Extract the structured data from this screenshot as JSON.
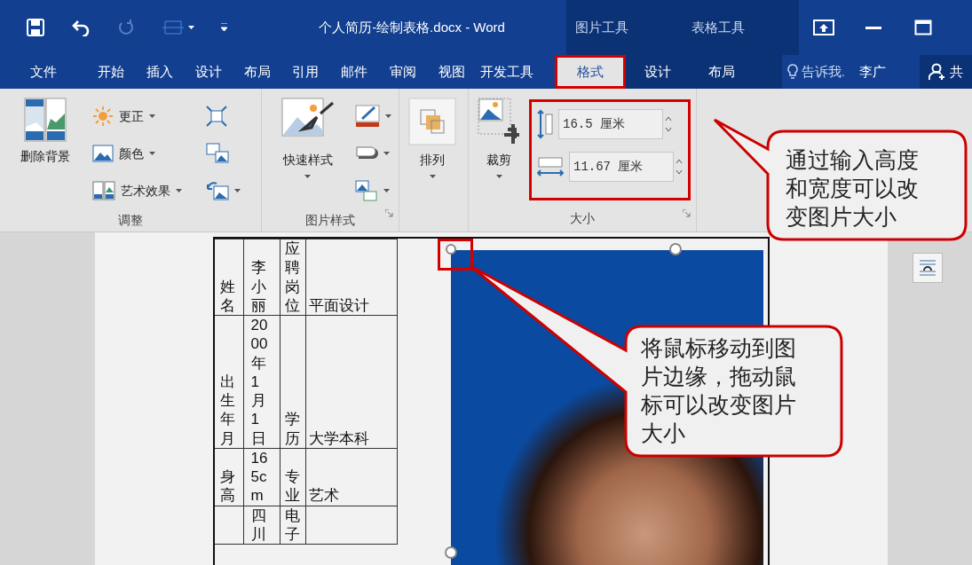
{
  "title_bar": {
    "title": "个人简历-绘制表格.docx - Word",
    "context_labels": [
      "图片工具",
      "表格工具"
    ]
  },
  "tabs": [
    {
      "label": "文件",
      "selected": false,
      "contextual": false,
      "highlighted": false
    },
    {
      "label": "开始",
      "selected": false,
      "contextual": false,
      "highlighted": false
    },
    {
      "label": "插入",
      "selected": false,
      "contextual": false,
      "highlighted": false
    },
    {
      "label": "设计",
      "selected": false,
      "contextual": false,
      "highlighted": false
    },
    {
      "label": "布局",
      "selected": false,
      "contextual": false,
      "highlighted": false
    },
    {
      "label": "引用",
      "selected": false,
      "contextual": false,
      "highlighted": false
    },
    {
      "label": "邮件",
      "selected": false,
      "contextual": false,
      "highlighted": false
    },
    {
      "label": "审阅",
      "selected": false,
      "contextual": false,
      "highlighted": false
    },
    {
      "label": "视图",
      "selected": false,
      "contextual": false,
      "highlighted": false
    },
    {
      "label": "开发工具",
      "selected": false,
      "contextual": false,
      "highlighted": false
    },
    {
      "label": "格式",
      "selected": true,
      "contextual": true,
      "highlighted": true
    },
    {
      "label": "设计",
      "selected": false,
      "contextual": true,
      "highlighted": false
    },
    {
      "label": "布局",
      "selected": false,
      "contextual": true,
      "highlighted": false
    }
  ],
  "tell_me": "告诉我.",
  "user": "李广",
  "share": "共",
  "ribbon": {
    "adjust": {
      "label": "调整",
      "remove_background": "删除背景",
      "commands": [
        "更正",
        "颜色",
        "艺术效果"
      ]
    },
    "picture_styles": {
      "label": "图片样式",
      "quick_styles": "快速样式"
    },
    "arrange": {
      "label": "排列"
    },
    "size": {
      "label": "大小",
      "crop": "裁剪",
      "height": "16.5 厘米",
      "width": "11.67 厘米",
      "highlighted": true
    }
  },
  "table": {
    "rows": [
      [
        "姓名",
        "李小丽",
        "应聘岗位",
        "平面设计"
      ],
      [
        "出生年月",
        "2000年1月1日",
        "学历",
        "大学本科"
      ],
      [
        "身高",
        "165cm",
        "专业",
        "艺术"
      ],
      [
        null,
        "四川",
        "电子",
        null
      ]
    ]
  },
  "photo": {
    "corner_handle_highlighted": true
  },
  "callouts": [
    {
      "text": "通过输入高度和宽度可以改变图片大小"
    },
    {
      "text": "将鼠标移动到图片边缘，拖动鼠标可以改变图片大小"
    }
  ]
}
